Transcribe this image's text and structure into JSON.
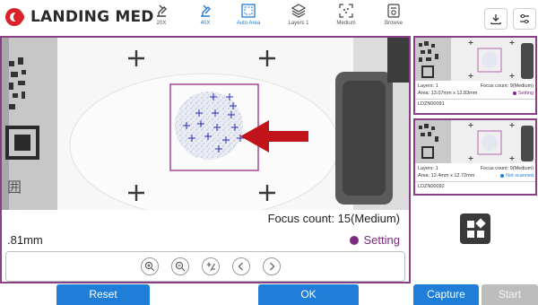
{
  "brand": {
    "name": "LANDING MED"
  },
  "toolbar": {
    "tools": [
      {
        "label": "20X",
        "icon": "objective-20x-icon"
      },
      {
        "label": "40X",
        "icon": "objective-40x-icon",
        "active": true
      },
      {
        "label": "Auto Area",
        "icon": "auto-area-icon",
        "active": true
      },
      {
        "label": "Layers 1",
        "icon": "layers-icon"
      },
      {
        "label": "Medium",
        "icon": "focus-medium-icon"
      },
      {
        "label": "Browse",
        "icon": "browse-icon"
      }
    ],
    "right_icons": [
      "download-icon",
      "filter-settings-icon"
    ]
  },
  "viewer": {
    "focus_count": "Focus count: 15(Medium)",
    "area": ".81mm",
    "status": {
      "label": "Setting",
      "color": "#7b2a7d"
    },
    "controls": [
      "zoom-in-icon",
      "zoom-out-icon",
      "plus-minus-icon",
      "previous-icon",
      "next-icon"
    ]
  },
  "slides": [
    {
      "layers": "Layers: 1",
      "focus": "Focus count: 9(Medium)",
      "area": "Area: 13.07mm x 12.83mm",
      "status": "Setting",
      "status_color": "#7b2a7d",
      "id": "LDZN00091"
    },
    {
      "layers": "Layers: 1",
      "focus": "Focus count: 9(Medium)",
      "area": "Area: 12.4mm x 12.72mm",
      "status": "Not scanned",
      "status_color": "#1f7ed8",
      "id": "LDZN00092"
    }
  ],
  "buttons": {
    "reset": "Reset",
    "ok": "OK",
    "capture": "Capture",
    "start": "Start"
  },
  "colors": {
    "accent": "#1f7ed8",
    "selection": "#8a3e86",
    "arrow": "#c0141a"
  }
}
